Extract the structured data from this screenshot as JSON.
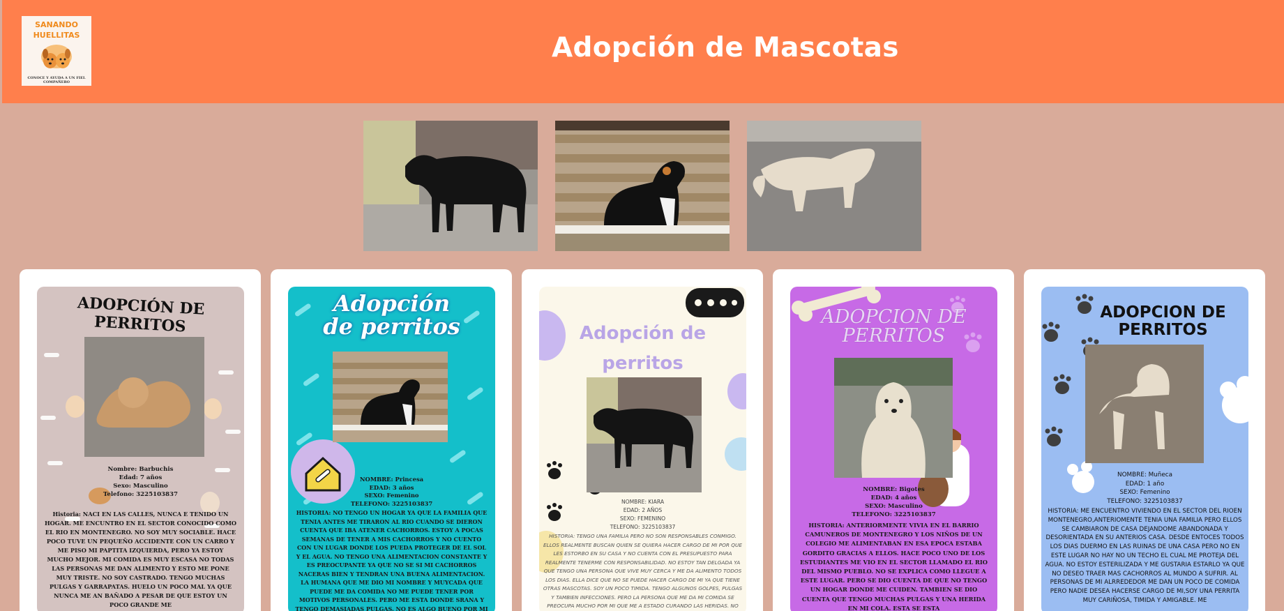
{
  "header": {
    "title": "Adopción de Mascotas",
    "logo_text": "SANANDO\nHUELLITAS",
    "logo_subtitle": "CONOCE Y AYUDA A UN FIEL COMPAÑERO"
  },
  "colors": {
    "header": "#ff7f4c",
    "background": "#d9ab9a",
    "card": "#ffffff"
  },
  "cards": [
    {
      "title": "ADOPCIÓN DE PERRITOS",
      "name": "Nombre: Barbuchis",
      "age": "Edad: 7 años",
      "sex": "Sexo: Masculino",
      "phone": "Telefono: 3225103837",
      "story": "Historia: NACI EN LAS CALLES, NUNCA E TENIDO UN HOGAR. ME ENCUNTRO EN EL SECTOR CONOCIDO COMO EL RIO EN MONTENEGRO. NO SOY MUY SOCIABLE. HACE POCO TUVE UN PEQUEÑO ACCIDENTE CON UN CARRO Y ME PISO MI PAPTITA IZQUIERDA, PERO YA ESTOY MUCHO MEJOR. MI COMIDA ES MUY ESCASA NO TODAS LAS PERSONAS ME DAN ALIMENTO Y ESTO ME PONE MUY TRISTE. NO SOY CASTRADO. TENGO MUCHAS PULGAS Y GARRAPATAS. HUELO UN POCO MAL YA QUE NUNCA ME AN BAÑADO A PESAR DE QUE ESTOY UN POCO GRANDE ME"
    },
    {
      "title": "Adopción\nde perritos",
      "name": "NOMBRE: Princesa",
      "age": "EDAD: 3 años",
      "sex": "SEXO: Femenino",
      "phone": "TELEFONO: 3225103837",
      "story": "HISTORIA: NO TENGO UN HOGAR YA QUE LA FAMILIA QUE TENIA ANTES ME TIRARON AL RIO CUANDO SE DIERON CUENTA QUE IBA ATENER CACHORROS. ESTOY A POCAS SEMANAS DE TENER A MIS CACHORROS Y NO CUENTO CON UN LUGAR DONDE LOS PUEDA PROTEGER DE EL SOL Y EL AGUA. NO TENGO UNA ALIMENTACION CONSTANTE Y ES PREOCUPANTE YA QUE NO SE SI MI CACHORROS NACERAS BIEN Y TENDRAN UNA BUENA ALIMENTACION. LA HUMANA QUE ME DIO MI NOMBRE Y MUYCADA QUE PUEDE ME DA COMIDA NO ME PUEDE TENER POR MOTIVOS PERSONALES. PERO ME ESTA DONDE SRANA Y TENGO DEMASIADAS PULGAS. NO ES ALGO BUENO POR MI ESTADO. POR ESO ESTOY EN BUCA"
    },
    {
      "title": "Adopción de\nperritos",
      "name": "NOMBRE: KIARA",
      "age": "EDAD: 2 AÑOS",
      "sex": "SEXO: FEMENINO",
      "phone": "TELEFONO: 3225103837",
      "story": "HISTORIA: TENGO UNA FAMILIA PERO NO SON RESPONSABLES CONMIGO. ELLOS REALMENTE BUSCAN QUIEN SE QUIERA HACER CARGO DE MI POR QUE LES ESTORBO EN SU CASA Y NO CUENTA CON EL PRESUPUESTO PARA REALMENTE TENERME CON RESPONSABILIDAD. NO ESTOY TAN DELGADA YA QUE TENGO UNA PERSONA QUE VIVE MUY CERCA Y ME DA ALIMENTO TODOS LOS DIAS. ELLA DICE QUE NO SE PUEDE HACER CARGO DE MI YA QUE TIENE OTRAS MASCOTAS. SOY UN POCO TIMIDA. TENGO ALGUNOS GOLPES, PULGAS Y TAMBIEN INFECCIONES. PERO LA PERSONA QUE ME DA MI COMIDA SE PREOCUPA MUCHO POR MI QUE ME A ESTADO CURANDO LAS HERIDAS. NO SOY OPERADA. REALMENTE ME"
    },
    {
      "title": "ADOPCION DE\nPERRITOS",
      "name": "NOMBRE: Bigotes",
      "age": "EDAD: 4 años",
      "sex": "SEXO: Masculino",
      "phone": "TELEFONO: 3225103837",
      "story": "HISTORIA: ANTERIORMENTE VIVIA EN EL BARRIO CAMUNEROS DE MONTENEGRO Y LOS NIÑOS DE UN COLEGIO ME ALIMENTABAN EN ESA EPOCA ESTABA GORDITO GRACIAS A ELLOS. HACE POCO UNO DE LOS ESTUDIANTES ME VIO EN EL SECTOR LLAMADO EL RIO DEL MISMO PUEBLO. NO SE EXPLICA COMO LLEGUE A ESTE LUGAR. PERO SE DIO CUENTA DE QUE NO TENGO UN HOGAR DONDE ME CUIDEN. TAMBIEN SE DIO CUENTA QUE TENGO MUCHAS PULGAS Y UNA HERIDA EN MI COLA. ESTA SE ESTA"
    },
    {
      "title": "ADOPCION DE\nPERRITOS",
      "name": "NOMBRE: Muñeca",
      "age": "EDAD: 1 año",
      "sex": "SEXO: Femenino",
      "phone": "TELEFONO: 3225103837",
      "story": "HISTORIA: ME ENCUENTRO VIVIENDO EN EL SECTOR DEL RIOEN MONTENEGRO,ANTERIOMENTE TENIA UNA FAMILIA PERO ELLOS SE CAMBIARON DE CASA DEJANDOME ABANDONADA Y DESORIENTADA EN SU ANTERIOS CASA. DESDE ENTOCES TODOS LOS DIAS DUERMO EN LAS RUINAS DE UNA CASA PERO NO EN ESTE LUGAR NO HAY NO UN TECHO EL CUAL ME PROTEJA DEL AGUA. NO ESTOY ESTERILIZADA Y ME GUSTARIA ESTARLO YA QUE NO DESEO TRAER MAS CACHORROS AL MUNDO A SUFRIR. AL PERSONAS DE MI ALRREDEDOR ME DAN UN POCO DE COMIDA PERO NADIE DESEA HACERSE CARGO DE MI,SOY UNA PERRITA MUY CARIÑOSA, TIMIDA Y AMIGABLE. ME"
    }
  ]
}
